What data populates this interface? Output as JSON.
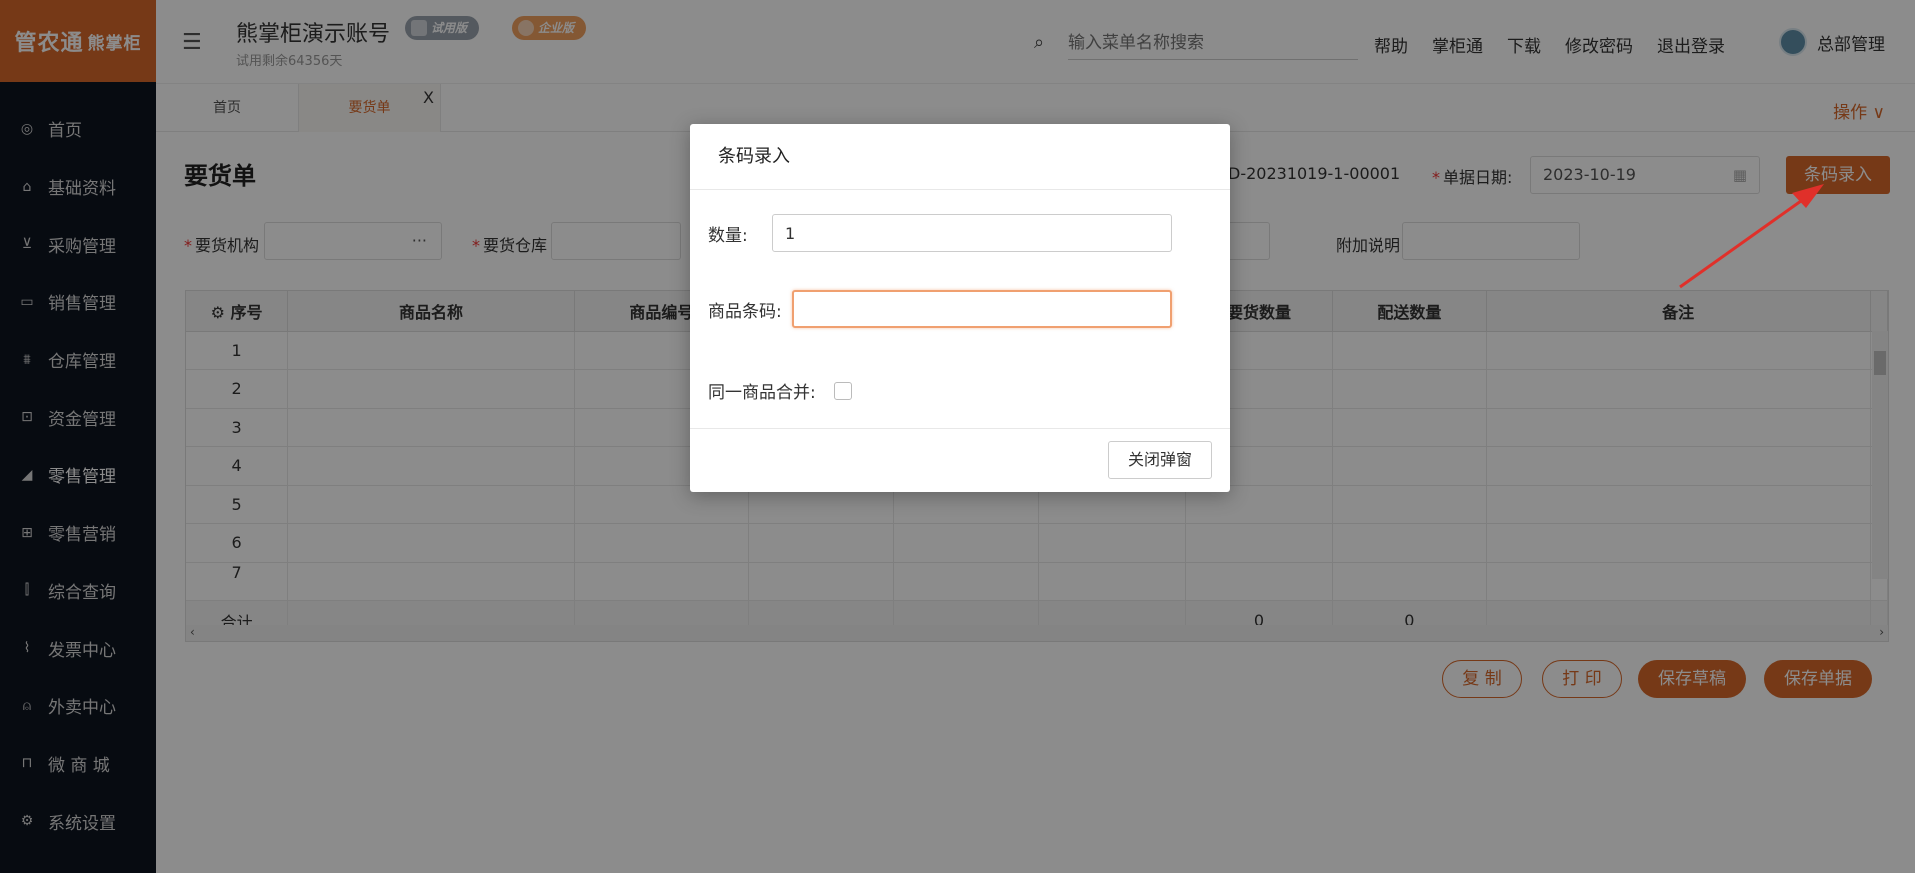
{
  "brand": {
    "logo_text": "管农通",
    "logo_sub": "熊掌柜"
  },
  "sidebar": {
    "items": [
      {
        "label": "首页",
        "icon": "globe-icon"
      },
      {
        "label": "基础资料",
        "icon": "home-icon"
      },
      {
        "label": "采购管理",
        "icon": "cart-icon"
      },
      {
        "label": "销售管理",
        "icon": "calendar-icon"
      },
      {
        "label": "仓库管理",
        "icon": "bank-icon"
      },
      {
        "label": "资金管理",
        "icon": "money-icon"
      },
      {
        "label": "零售管理",
        "icon": "chart-icon"
      },
      {
        "label": "零售营销",
        "icon": "gift-icon"
      },
      {
        "label": "综合查询",
        "icon": "bar-chart-icon"
      },
      {
        "label": "发票中心",
        "icon": "line-chart-icon"
      },
      {
        "label": "外卖中心",
        "icon": "alarm-icon"
      },
      {
        "label": "微 商 城",
        "icon": "bag-icon"
      },
      {
        "label": "系统设置",
        "icon": "gear-icon"
      }
    ]
  },
  "header": {
    "title": "熊掌柜演示账号",
    "subtitle": "试用剩余64356天",
    "badge_trial": "试用版",
    "badge_enterprise": "企业版",
    "search_placeholder": "输入菜单名称搜索",
    "links": [
      "帮助",
      "掌柜通",
      "下载",
      "修改密码",
      "退出登录"
    ],
    "user": "总部管理"
  },
  "tabs": {
    "home": "首页",
    "order": "要货单",
    "close": "X",
    "ops": "操作 ∨"
  },
  "form": {
    "page_title": "要货单",
    "doc_no": "D-20231019-1-00001",
    "date_label": "单据日期:",
    "date_value": "2023-10-19",
    "barcode_button": "条码录入",
    "org_label": "要货机构",
    "org_value": "···",
    "warehouse_label": "要货仓库",
    "note_label": "附加说明",
    "required_mark": "*"
  },
  "table": {
    "headers": [
      "序号",
      "商品名称",
      "商品编号",
      "",
      "",
      "",
      "要货数量",
      "配送数量",
      "备注"
    ],
    "rows": [
      "1",
      "2",
      "3",
      "4",
      "5",
      "6",
      "7"
    ],
    "sum_label": "合计",
    "sum_qty": "0",
    "sum_delivery": "0"
  },
  "actions": {
    "copy": "复 制",
    "print": "打 印",
    "save_draft": "保存草稿",
    "save_doc": "保存单据"
  },
  "dialog": {
    "title": "条码录入",
    "qty_label": "数量:",
    "qty_value": "1",
    "barcode_label": "商品条码:",
    "barcode_value": "",
    "merge_label": "同一商品合并:",
    "close_button": "关闭弹窗"
  },
  "colors": {
    "accent": "#d8682a",
    "sidebar": "#0d1420"
  }
}
